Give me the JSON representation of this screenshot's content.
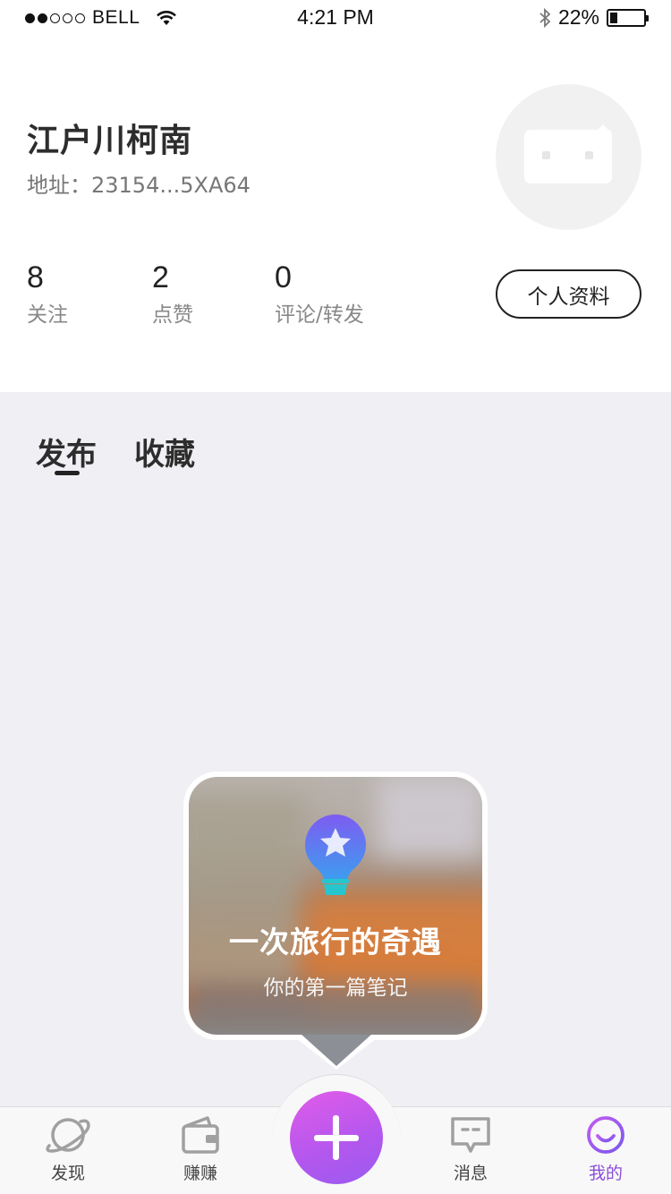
{
  "status_bar": {
    "carrier": "BELL",
    "time": "4:21 PM",
    "battery": "22%"
  },
  "profile": {
    "name": "江户川柯南",
    "address": "地址：23154...5XA64",
    "avatar_icon": "bot-face-icon",
    "edit_button": "个人资料"
  },
  "stats": [
    {
      "value": "8",
      "label": "关注"
    },
    {
      "value": "2",
      "label": "点赞"
    },
    {
      "value": "0",
      "label": "评论/转发"
    }
  ],
  "tabs": [
    {
      "label": "发布",
      "active": true
    },
    {
      "label": "收藏",
      "active": false
    }
  ],
  "empty_card": {
    "icon": "star-balloon-icon",
    "title": "一次旅行的奇遇",
    "subtitle": "你的第一篇笔记"
  },
  "tab_bar": {
    "items": [
      {
        "label": "发现",
        "icon": "planet-icon"
      },
      {
        "label": "赚赚",
        "icon": "wallet-icon"
      },
      {
        "label": "",
        "icon": "plus-icon"
      },
      {
        "label": "消息",
        "icon": "message-icon"
      },
      {
        "label": "我的",
        "icon": "smile-icon",
        "active": true
      }
    ]
  },
  "colors": {
    "accent": "#9b59f0",
    "accent_pink": "#e15ce9",
    "background_grey": "#f0eff3"
  }
}
